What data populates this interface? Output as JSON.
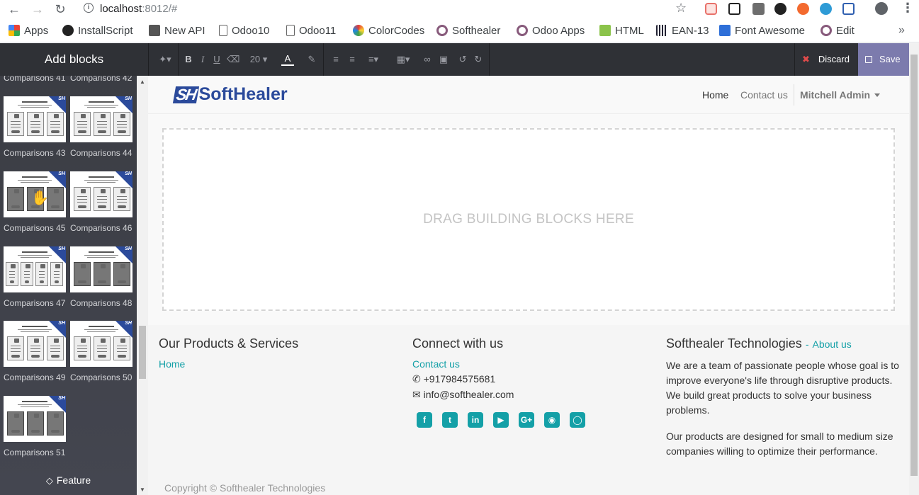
{
  "browser": {
    "url_host": "localhost",
    "url_rest": ":8012/#",
    "bookmarks": [
      "Apps",
      "InstallScript",
      "New API",
      "Odoo10",
      "Odoo11",
      "ColorCodes",
      "Softhealer",
      "Odoo Apps",
      "HTML",
      "EAN-13",
      "Font Awesome",
      "Edit"
    ]
  },
  "editor": {
    "panel_title": "Add blocks",
    "font_size": "20",
    "discard_label": "Discard",
    "save_label": "Save"
  },
  "snippets": [
    {
      "label": "Comparisons 41"
    },
    {
      "label": "Comparisons 42"
    },
    {
      "label": "Comparisons 43"
    },
    {
      "label": "Comparisons 44"
    },
    {
      "label": "Comparisons 45"
    },
    {
      "label": "Comparisons 46"
    },
    {
      "label": "Comparisons 47"
    },
    {
      "label": "Comparisons 48"
    },
    {
      "label": "Comparisons 49"
    },
    {
      "label": "Comparisons 50"
    },
    {
      "label": "Comparisons 51"
    }
  ],
  "snippet_badge": "SH",
  "next_category": "Feature",
  "site": {
    "logo_text": "SoftHealer",
    "logo_mark": "SH",
    "menu": [
      "Home",
      "Contact us"
    ],
    "user": "Mitchell Admin",
    "dropzone_text": "DRAG BUILDING BLOCKS HERE",
    "footer": {
      "products_title": "Our Products & Services",
      "products_link": "Home",
      "connect_title": "Connect with us",
      "connect_link": "Contact us",
      "phone": "+917984575681",
      "email": "info@softhealer.com",
      "company_title": "Softhealer Technologies",
      "about_link": "About us",
      "para1": "We are a team of passionate people whose goal is to improve everyone's life through disruptive products. We build great products to solve your business problems.",
      "para2": "Our products are designed for small to medium size companies willing to optimize their performance.",
      "social_icons": [
        "facebook-icon",
        "twitter-icon",
        "linkedin-icon",
        "youtube-icon",
        "google-plus-icon",
        "github-icon",
        "instagram-icon"
      ]
    },
    "copyright": "Copyright © Softhealer Technologies"
  },
  "colors": {
    "accent": "#14a0a7",
    "brand": "#2b4a9b",
    "save": "#7c7bad",
    "editor_bar": "#2f3136"
  }
}
